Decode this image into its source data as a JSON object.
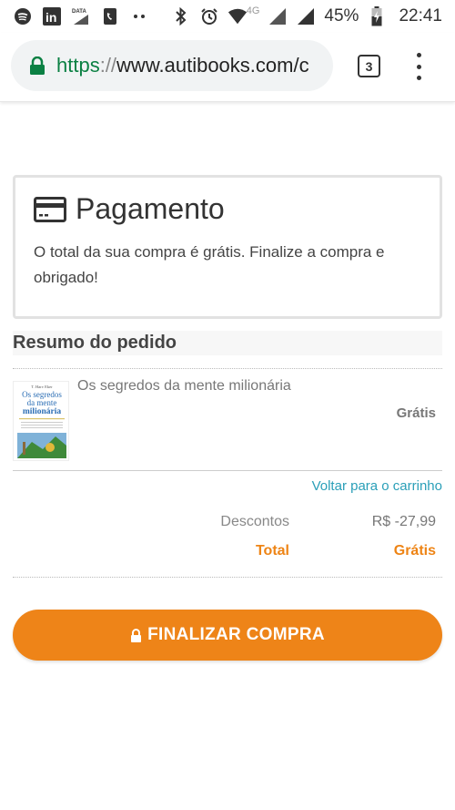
{
  "status_bar": {
    "battery": "45%",
    "network": "4G",
    "time": "22:41",
    "data_label": "DATA",
    "linkedin_label": "in"
  },
  "browser": {
    "url_scheme": "https",
    "url_sep": "://",
    "url_host": "www.autibooks.com/c",
    "tab_count": "3"
  },
  "payment": {
    "title": "Pagamento",
    "description": "O total da sua compra é grátis. Finalize a compra e obrigado!"
  },
  "summary": {
    "title": "Resumo do pedido",
    "item": {
      "title": "Os segredos da mente milionária",
      "price": "Grátis",
      "cover": {
        "author": "T. Harv Eker",
        "line1": "Os segredos",
        "line2": "da mente",
        "line3": "milionária"
      }
    },
    "back_link": "Voltar para o carrinho",
    "discount_label": "Descontos",
    "discount_value": "R$ -27,99",
    "total_label": "Total",
    "total_value": "Grátis"
  },
  "actions": {
    "finalize_label": "FINALIZAR COMPRA"
  },
  "colors": {
    "accent": "#ee8418",
    "link": "#2a9fb8",
    "secure": "#0b8043"
  }
}
